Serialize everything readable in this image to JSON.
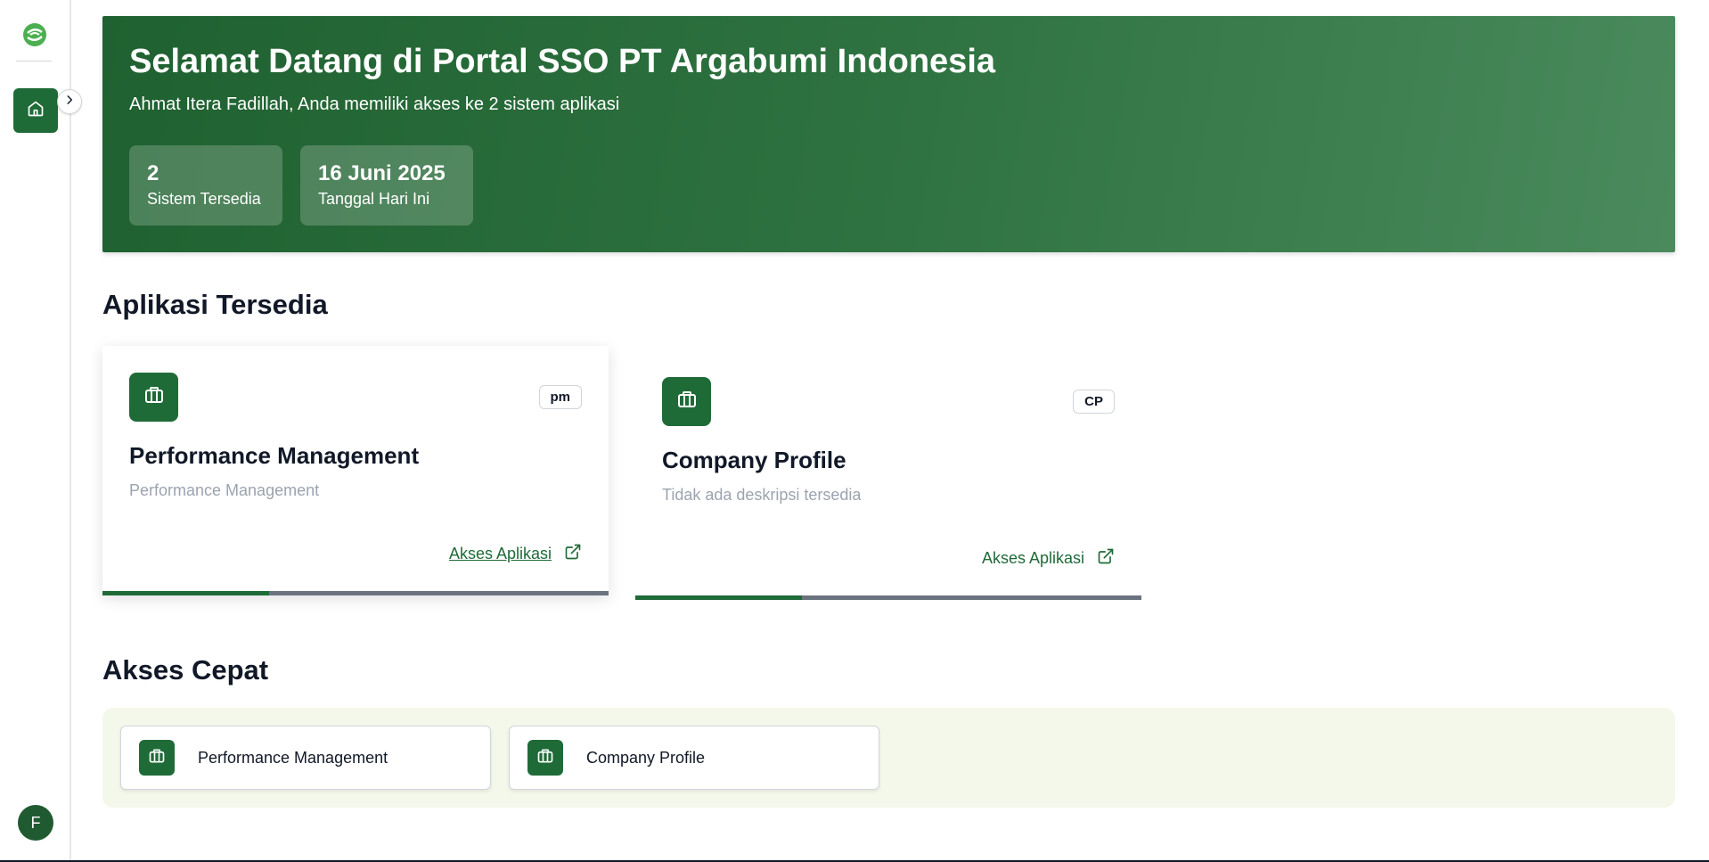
{
  "sidebar": {
    "logo_icon": "argabumi-logo-icon",
    "nav_items": [
      {
        "icon": "home-icon",
        "active": true
      }
    ],
    "collapse_icon": "chevron-right-icon",
    "avatar_initial": "F"
  },
  "hero": {
    "title": "Selamat Datang di Portal SSO PT Argabumi Indonesia",
    "subtitle": "Ahmat Itera Fadillah, Anda memiliki akses ke 2 sistem aplikasi",
    "stats": [
      {
        "value": "2",
        "label": "Sistem Tersedia"
      },
      {
        "value": "16 Juni 2025",
        "label": "Tanggal Hari Ini"
      }
    ]
  },
  "apps_section": {
    "title": "Aplikasi Tersedia",
    "cards": [
      {
        "icon": "briefcase-icon",
        "code": "pm",
        "title": "Performance Management",
        "description": "Performance Management",
        "link_label": "Akses Aplikasi",
        "link_icon": "external-link-icon",
        "progress": 0.33
      },
      {
        "icon": "briefcase-icon",
        "code": "CP",
        "title": "Company Profile",
        "description": "Tidak ada deskripsi tersedia",
        "link_label": "Akses Aplikasi",
        "link_icon": "external-link-icon",
        "progress": 0.33
      }
    ]
  },
  "quick_section": {
    "title": "Akses Cepat",
    "items": [
      {
        "icon": "briefcase-icon",
        "label": "Performance Management"
      },
      {
        "icon": "briefcase-icon",
        "label": "Company Profile"
      }
    ]
  },
  "colors": {
    "primary": "#1f6b38",
    "quick_bg": "#f4f8ea",
    "muted_text": "#9ca3af"
  }
}
